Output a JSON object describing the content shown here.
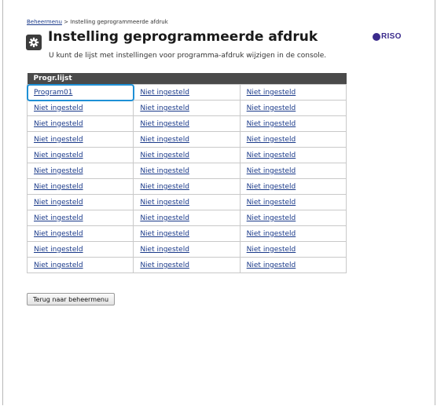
{
  "breadcrumb": {
    "link": "Beheermenu",
    "separator": ">",
    "current": "Instelling geprogrammeerde afdruk"
  },
  "header": {
    "title": "Instelling geprogrammeerde afdruk",
    "subtitle": "U kunt de lijst met instellingen voor programma-afdruk wijzigen in de console.",
    "icon": "gear-icon"
  },
  "logo": {
    "text": "RISO",
    "color": "#3a2a8c"
  },
  "table": {
    "header": "Progr.lijst",
    "rows": [
      [
        "Program01",
        "Niet ingesteld",
        "Niet ingesteld"
      ],
      [
        "Niet ingesteld",
        "Niet ingesteld",
        "Niet ingesteld"
      ],
      [
        "Niet ingesteld",
        "Niet ingesteld",
        "Niet ingesteld"
      ],
      [
        "Niet ingesteld",
        "Niet ingesteld",
        "Niet ingesteld"
      ],
      [
        "Niet ingesteld",
        "Niet ingesteld",
        "Niet ingesteld"
      ],
      [
        "Niet ingesteld",
        "Niet ingesteld",
        "Niet ingesteld"
      ],
      [
        "Niet ingesteld",
        "Niet ingesteld",
        "Niet ingesteld"
      ],
      [
        "Niet ingesteld",
        "Niet ingesteld",
        "Niet ingesteld"
      ],
      [
        "Niet ingesteld",
        "Niet ingesteld",
        "Niet ingesteld"
      ],
      [
        "Niet ingesteld",
        "Niet ingesteld",
        "Niet ingesteld"
      ],
      [
        "Niet ingesteld",
        "Niet ingesteld",
        "Niet ingesteld"
      ],
      [
        "Niet ingesteld",
        "Niet ingesteld",
        "Niet ingesteld"
      ]
    ],
    "selected_color": "#1e90d6"
  },
  "footer": {
    "back_label": "Terug naar beheermenu"
  }
}
